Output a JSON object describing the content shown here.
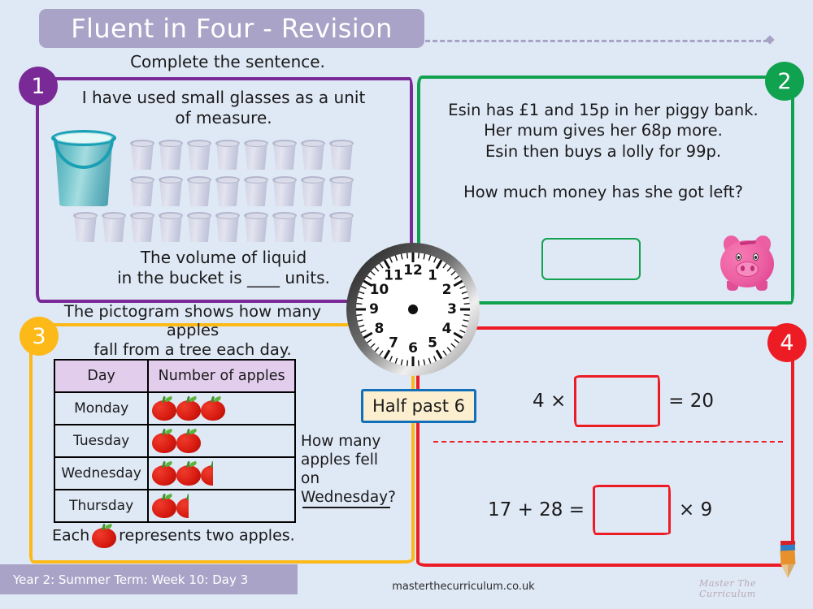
{
  "header": {
    "title": "Fluent in Four - Revision",
    "banner_color": "#aaa3c8"
  },
  "questions": [
    {
      "number": "1",
      "color": "#7a2a96",
      "prompt": "Complete the sentence.",
      "statement": "I have used small glasses as a unit of measure.",
      "bottom_text": "The volume of liquid\nin the bucket is ____ units.",
      "bottom_line1": "The volume of liquid",
      "bottom_line2": "in the bucket is ____ units.",
      "bucket_icon": "bucket-icon",
      "glass_icon": "glass-icon",
      "glass_rows": [
        8,
        8,
        10
      ],
      "glass_total": 26
    },
    {
      "number": "2",
      "color": "#11a24f",
      "line1": "Esin has £1 and 15p in her piggy bank.",
      "line2": "Her mum gives her 68p more.",
      "line3": "Esin then buys a lolly for 99p.",
      "question": "How much money has she got left?",
      "answer_value": "",
      "piggy_icon": "piggy-bank-icon"
    },
    {
      "number": "3",
      "color": "#fcb917",
      "prompt_line1": "The pictogram shows how many apples",
      "prompt_line2": "fall from a tree each day.",
      "table": {
        "headers": [
          "Day",
          "Number of apples"
        ],
        "rows": [
          {
            "day": "Monday",
            "full_apples": 3,
            "half_apple": false
          },
          {
            "day": "Tuesday",
            "full_apples": 2,
            "half_apple": false
          },
          {
            "day": "Wednesday",
            "full_apples": 2,
            "half_apple": true
          },
          {
            "day": "Thursday",
            "full_apples": 1,
            "half_apple": true
          }
        ]
      },
      "question_line1": "How many",
      "question_line2": "apples fell on",
      "question_line3": "Wednesday?",
      "answer_value": "",
      "key_before": "Each",
      "key_after": "represents two apples.",
      "apple_icon": "apple-icon"
    },
    {
      "number": "4",
      "color": "#ed1c24",
      "equation1": {
        "left": "4 ×",
        "box": "",
        "right": "= 20"
      },
      "equation2": {
        "left": "17 + 28 =",
        "box": "",
        "right": "× 9"
      }
    }
  ],
  "clock": {
    "icon": "analog-clock-icon",
    "numerals": [
      "1",
      "2",
      "3",
      "4",
      "5",
      "6",
      "7",
      "8",
      "9",
      "10",
      "11",
      "12"
    ],
    "label": "Half past 6",
    "label_border_color": "#1270b8",
    "label_bg_color": "#fbefcf",
    "hands_shown": false
  },
  "footer": {
    "lesson_info": "Year 2: Summer Term: Week 10: Day 3",
    "website": "masterthecurriculum.co.uk",
    "logo_text": "Master The Curriculum",
    "logo_icon": "pencil-icon"
  },
  "colors": {
    "page_background": "#dfe8f5",
    "purple": "#7a2a96",
    "green": "#11a24f",
    "orange": "#fcb917",
    "red": "#ed1c24",
    "banner": "#aaa3c8",
    "table_header": "#e2cdec"
  }
}
